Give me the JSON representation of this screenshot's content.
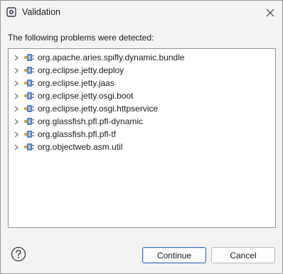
{
  "window": {
    "title": "Validation",
    "close_icon": "close-icon",
    "app_icon": "eclipse-icon"
  },
  "dialog": {
    "message": "The following problems were detected:"
  },
  "problems": [
    {
      "label": "org.apache.aries.spifly.dynamic.bundle",
      "icon": "plugin-icon",
      "expanded": false
    },
    {
      "label": "org.eclipse.jetty.deploy",
      "icon": "plugin-icon",
      "expanded": false
    },
    {
      "label": "org.eclipse.jetty.jaas",
      "icon": "plugin-icon",
      "expanded": false
    },
    {
      "label": "org.eclipse.jetty.osgi.boot",
      "icon": "plugin-icon",
      "expanded": false
    },
    {
      "label": "org.eclipse.jetty.osgi.httpservice",
      "icon": "plugin-icon",
      "expanded": false
    },
    {
      "label": "org.glassfish.pfl.pfl-dynamic",
      "icon": "plugin-icon",
      "expanded": false
    },
    {
      "label": "org.glassfish.pfl.pfl-tf",
      "icon": "plugin-icon",
      "expanded": false
    },
    {
      "label": "org.objectweb.asm.util",
      "icon": "plugin-icon",
      "expanded": false
    }
  ],
  "buttons": {
    "help_icon": "help-icon",
    "continue_label": "Continue",
    "cancel_label": "Cancel"
  },
  "colors": {
    "dialog_bg": "#f3f3f3",
    "default_button_border": "#2e6fc3",
    "plugin_icon_blue": "#4f82c2",
    "plugin_icon_orange": "#e5a23a"
  }
}
